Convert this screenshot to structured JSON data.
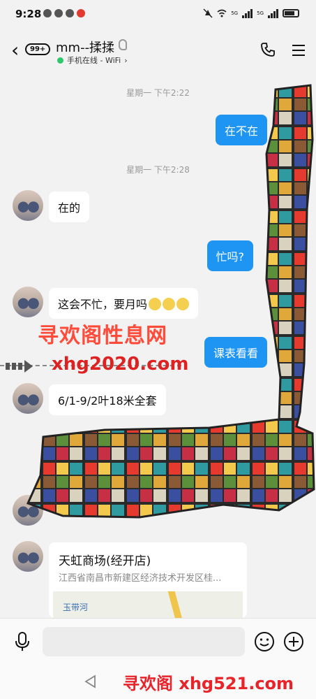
{
  "status_bar": {
    "time": "9:28",
    "signal_label_1": "5G",
    "signal_label_2": "5G"
  },
  "header": {
    "unread_badge": "99+",
    "title": "mm--揉揉",
    "subtitle": "手机在线 - WiFi",
    "subtitle_chevron": "›"
  },
  "messages": [
    {
      "type": "timestamp",
      "text": "星期一 下午2:22"
    },
    {
      "type": "sent",
      "text": "在不在"
    },
    {
      "type": "timestamp",
      "text": "星期一 下午2:28"
    },
    {
      "type": "received",
      "text": "在的"
    },
    {
      "type": "sent",
      "text": "忙吗?"
    },
    {
      "type": "received",
      "text": "这会不忙，要月吗"
    },
    {
      "type": "sent",
      "text": "课表看看"
    },
    {
      "type": "received",
      "text": "6/1-9/2叶18米全套"
    },
    {
      "type": "received_location",
      "title": "天虹商场(经开店)",
      "address": "江西省南昌市新建区经济技术开发区桂...",
      "map_label": "玉带河"
    }
  ],
  "watermarks": {
    "site_name": "寻欢阁性息网",
    "site_url": "xhg2020.com",
    "footer": "寻欢阁 xhg521.com"
  },
  "input": {
    "placeholder": ""
  },
  "colors": {
    "sent_bubble": "#1e95f3",
    "online_dot": "#2ec86b",
    "background": "#f2f2f2"
  },
  "icons": [
    "back-icon",
    "ear-icon",
    "phone-icon",
    "menu-icon",
    "mic-icon",
    "smile-icon",
    "plus-icon",
    "nav-back-icon"
  ]
}
